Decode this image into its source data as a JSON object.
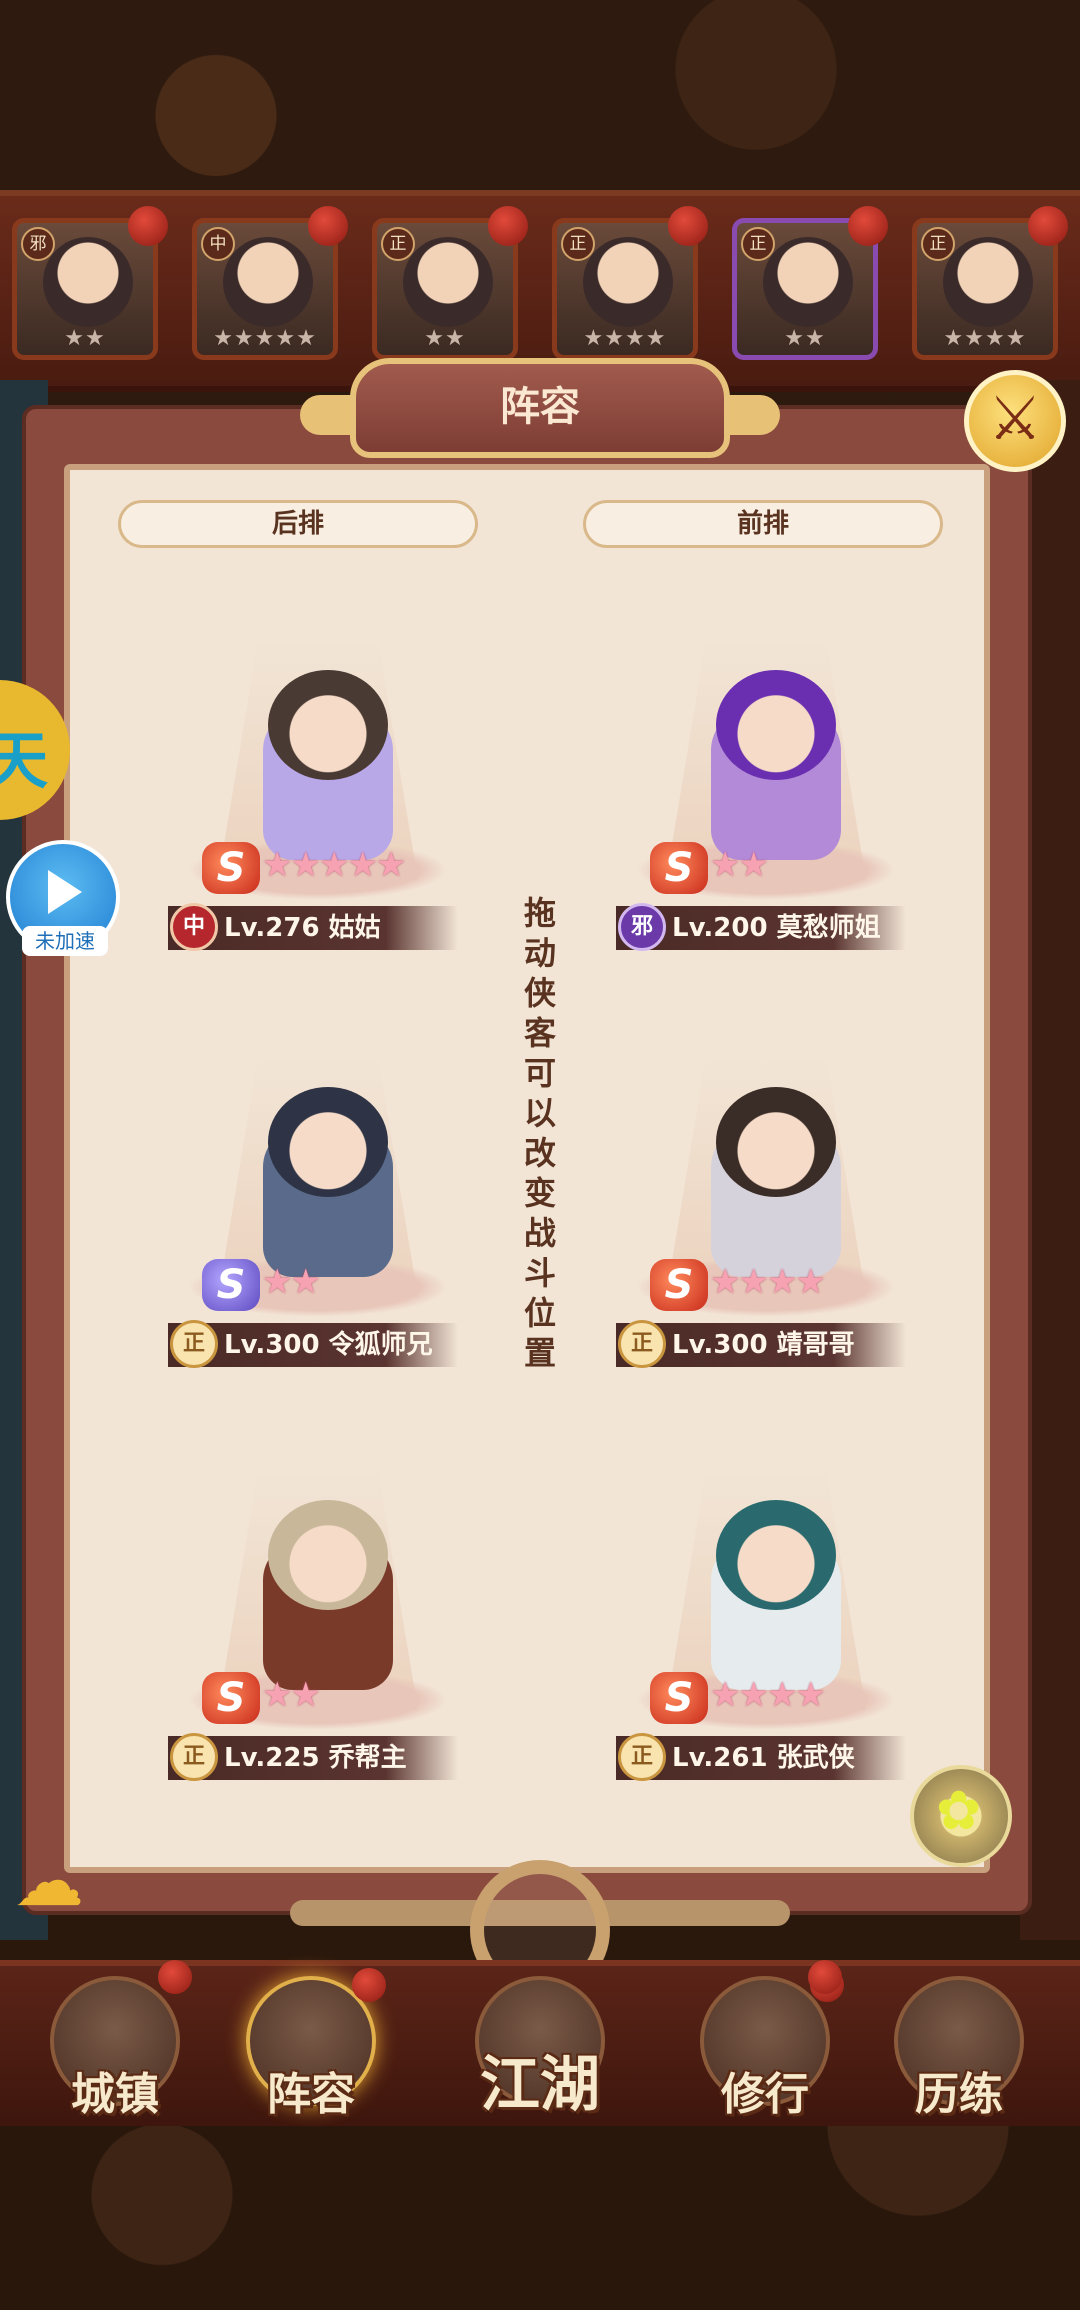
{
  "roster": [
    {
      "faction": "邪",
      "stars": "★★",
      "purple": false
    },
    {
      "faction": "中",
      "stars": "★★★★★",
      "purple": false
    },
    {
      "faction": "正",
      "stars": "★★",
      "purple": false
    },
    {
      "faction": "正",
      "stars": "★★★★",
      "purple": false
    },
    {
      "faction": "正",
      "stars": "★★",
      "purple": true
    },
    {
      "faction": "正",
      "stars": "★★★★",
      "purple": false
    }
  ],
  "panel": {
    "title": "阵容",
    "back_row_label": "后排",
    "front_row_label": "前排",
    "hint": "拖动侠客可以改变战斗位置",
    "close_icon": "⚔"
  },
  "heroes": [
    {
      "faction": "中",
      "level": "Lv.276",
      "name": "姑姑",
      "stars": "★★★★★",
      "badge": "S",
      "hair": "#4a3a34",
      "body": "#b9a8e8"
    },
    {
      "faction": "邪",
      "level": "Lv.200",
      "name": "莫愁师姐",
      "stars": "★★",
      "badge": "S",
      "hair": "#6a2fb0",
      "body": "#b28ad8"
    },
    {
      "faction": "正",
      "level": "Lv.300",
      "name": "令狐师兄",
      "stars": "★★",
      "badge": "S",
      "hair": "#2e3446",
      "body": "#5a6a8a"
    },
    {
      "faction": "正",
      "level": "Lv.300",
      "name": "靖哥哥",
      "stars": "★★★★",
      "badge": "S",
      "hair": "#3a2c26",
      "body": "#d5d2dc"
    },
    {
      "faction": "正",
      "level": "Lv.225",
      "name": "乔帮主",
      "stars": "★★",
      "badge": "S",
      "hair": "#c9b79a",
      "body": "#7a3a2a"
    },
    {
      "faction": "正",
      "level": "Lv.261",
      "name": "张武侠",
      "stars": "★★★★",
      "badge": "S",
      "hair": "#2a6a6e",
      "body": "#e6ecee"
    }
  ],
  "speed": {
    "label": "未加速"
  },
  "side_badge": "天",
  "nav": [
    {
      "label": "城镇"
    },
    {
      "label": "阵容"
    },
    {
      "label": "江湖"
    },
    {
      "label": "修行"
    },
    {
      "label": "历练"
    }
  ]
}
